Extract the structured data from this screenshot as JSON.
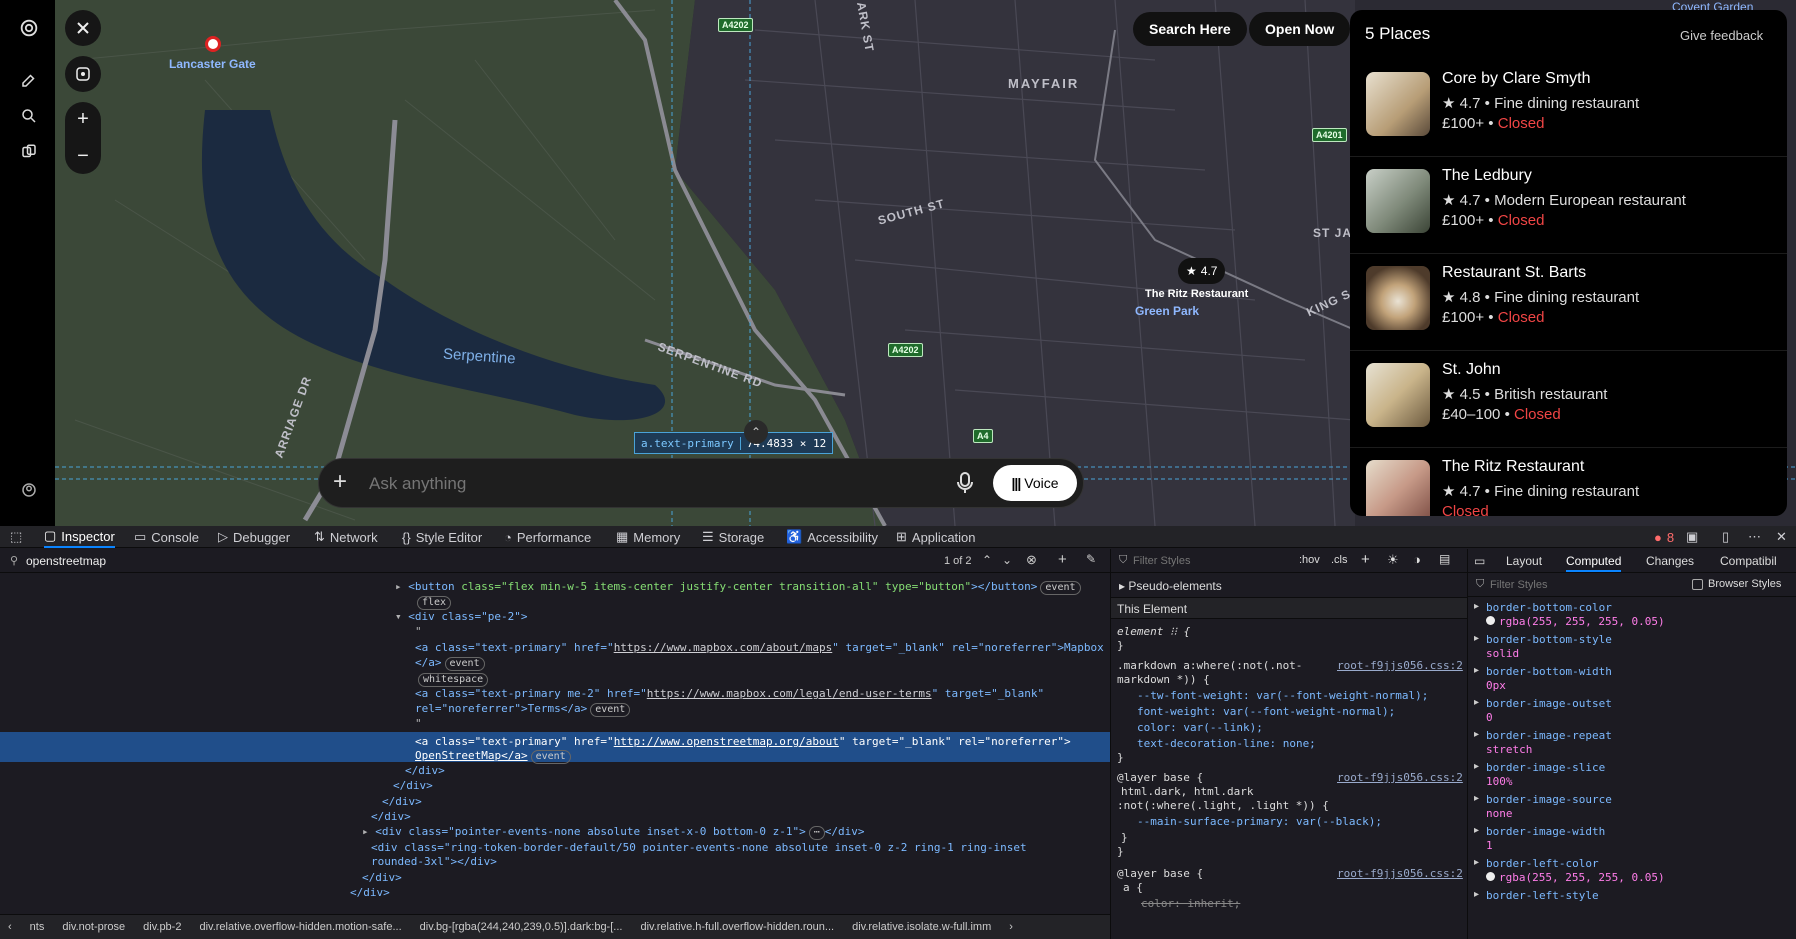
{
  "map": {
    "buttons": {
      "search_here": "Search Here",
      "open_now": "Open Now"
    },
    "labels": {
      "lancaster_gate": "Lancaster Gate",
      "mayfair": "MAYFAIR",
      "serpentine": "Serpentine",
      "serpentine_rd": "SERPENTINE RD",
      "south_st": "SOUTH ST",
      "ark_st": "ARK ST",
      "carriage_dr": "ARRIAGE DR",
      "st_j": "ST JA",
      "king_s": "KING S",
      "covent_garden": "Covent Garden",
      "green_park": "Green Park",
      "ritz_label": "The Ritz Restaurant",
      "ritz_rating": "4.7",
      "a4202": "A4202",
      "a4202b": "A4202",
      "a4201": "A4201",
      "a4": "A4"
    },
    "overlay": {
      "selector": "a.text-primary",
      "size": "74.4833 × 12"
    }
  },
  "panel": {
    "title": "5 Places",
    "feedback": "Give feedback",
    "places": [
      {
        "name": "Core by Clare Smyth",
        "rating": "4.7",
        "category": "Fine dining restaurant",
        "price": "£100+",
        "status": "Closed"
      },
      {
        "name": "The Ledbury",
        "rating": "4.7",
        "category": "Modern European restaurant",
        "price": "£100+",
        "status": "Closed"
      },
      {
        "name": "Restaurant St. Barts",
        "rating": "4.8",
        "category": "Fine dining restaurant",
        "price": "£100+",
        "status": "Closed"
      },
      {
        "name": "St. John",
        "rating": "4.5",
        "category": "British restaurant",
        "price": "£40–100",
        "status": "Closed"
      },
      {
        "name": "The Ritz Restaurant",
        "rating": "4.7",
        "category": "Fine dining restaurant",
        "price": "",
        "status": "Closed"
      }
    ]
  },
  "ask": {
    "placeholder": "Ask anything",
    "voice": "Voice"
  },
  "devtools": {
    "tabs": [
      "Inspector",
      "Console",
      "Debugger",
      "Network",
      "Style Editor",
      "Performance",
      "Memory",
      "Storage",
      "Accessibility",
      "Application"
    ],
    "error_count": "8",
    "search": {
      "value": "openstreetmap",
      "result": "1 of 2"
    },
    "html_lines": {
      "l1_pre": "<button ",
      "l1_attr": "class=\"flex min-w-5 items-center justify-center transition-all\" type=\"button\"",
      "l1_post": "></button>",
      "l1_badge": "event",
      "l1_flex": "flex",
      "l2": "<div class=\"pe-2\">",
      "l3": "\"",
      "l4_pre": "<a class=\"text-primary\" href=\"",
      "l4_href": "https://www.mapbox.com/about/maps",
      "l4_post": "\" target=\"_blank\" rel=\"noreferrer\">Mapbox",
      "l5": "</a>",
      "l5_badge": "event",
      "l6_badge": "whitespace",
      "l7_pre": "<a class=\"text-primary me-2\" href=\"",
      "l7_href": "https://www.mapbox.com/legal/end-user-terms",
      "l7_post": "\" target=\"_blank\"",
      "l8": "rel=\"noreferrer\">Terms</a>",
      "l8_badge": "event",
      "l9": "\"",
      "l10_pre": "<a class=\"text-primary\" href=\"",
      "l10_href": "http://www.openstreetmap.org/about",
      "l10_post": "\" target=\"_blank\" rel=\"noreferrer\">",
      "l11": "OpenStreetMap</a>",
      "l11_badge": "event",
      "l12": "</div>",
      "l13": "</div>",
      "l14": "</div>",
      "l15": "</div>",
      "l16": "<div class=\"pointer-events-none absolute inset-x-0 bottom-0 z-1\">",
      "l16_post": "</div>",
      "l17": "<div class=\"ring-token-border-default/50 pointer-events-none absolute inset-0 z-2 ring-1 ring-inset",
      "l18": "rounded-3xl\"></div>",
      "l19": "</div>",
      "l20": "</div>"
    },
    "breadcrumbs": [
      "nts",
      "div.not-prose",
      "div.pb-2",
      "div.relative.overflow-hidden.motion-safe...",
      "div.bg-[rgba(244,240,239,0.5)].dark:bg-[...",
      "div.relative.h-full.overflow-hidden.roun...",
      "div.relative.isolate.w-full.imm"
    ],
    "rules": {
      "filter_placeholder": "Filter Styles",
      "hov": ":hov",
      "cls": ".cls",
      "pseudo": "Pseudo-elements",
      "this_element": "This Element",
      "r1_sel": "element",
      "r2_sel": ".markdown a:where(:not(.not-",
      "r2_sel2": "markdown *)) {",
      "r2_src": "root-f9jjs056.css:2",
      "r2_l1": "--tw-font-weight: var(--font-weight-normal);",
      "r2_l2": "font-weight: var(--font-weight-normal);",
      "r2_l3": "color: var(--link);",
      "r2_l4": "text-decoration-line: none;",
      "r3_sel": "@layer base {",
      "r3_src": "root-f9jjs056.css:2",
      "r3_l1": "html.dark, html.dark",
      "r3_l2": ":not(:where(.light, .light *)) {",
      "r3_l3": "--main-surface-primary: var(--black);",
      "r4_sel": "@layer base {",
      "r4_src": "root-f9jjs056.css:2",
      "r4_l1": "a {",
      "r4_l2": "color: inherit;"
    },
    "computed": {
      "tabs": [
        "Layout",
        "Computed",
        "Changes",
        "Compatibil"
      ],
      "filter_placeholder": "Filter Styles",
      "browser_styles": "Browser Styles",
      "props": [
        {
          "name": "border-bottom-color",
          "value": "rgba(255, 255, 255, 0.05)"
        },
        {
          "name": "border-bottom-style",
          "value": "solid"
        },
        {
          "name": "border-bottom-width",
          "value": "0px"
        },
        {
          "name": "border-image-outset",
          "value": "0"
        },
        {
          "name": "border-image-repeat",
          "value": "stretch"
        },
        {
          "name": "border-image-slice",
          "value": "100%"
        },
        {
          "name": "border-image-source",
          "value": "none"
        },
        {
          "name": "border-image-width",
          "value": "1"
        },
        {
          "name": "border-left-color",
          "value": "rgba(255, 255, 255, 0.05)"
        },
        {
          "name": "border-left-style",
          "value": ""
        }
      ]
    }
  }
}
